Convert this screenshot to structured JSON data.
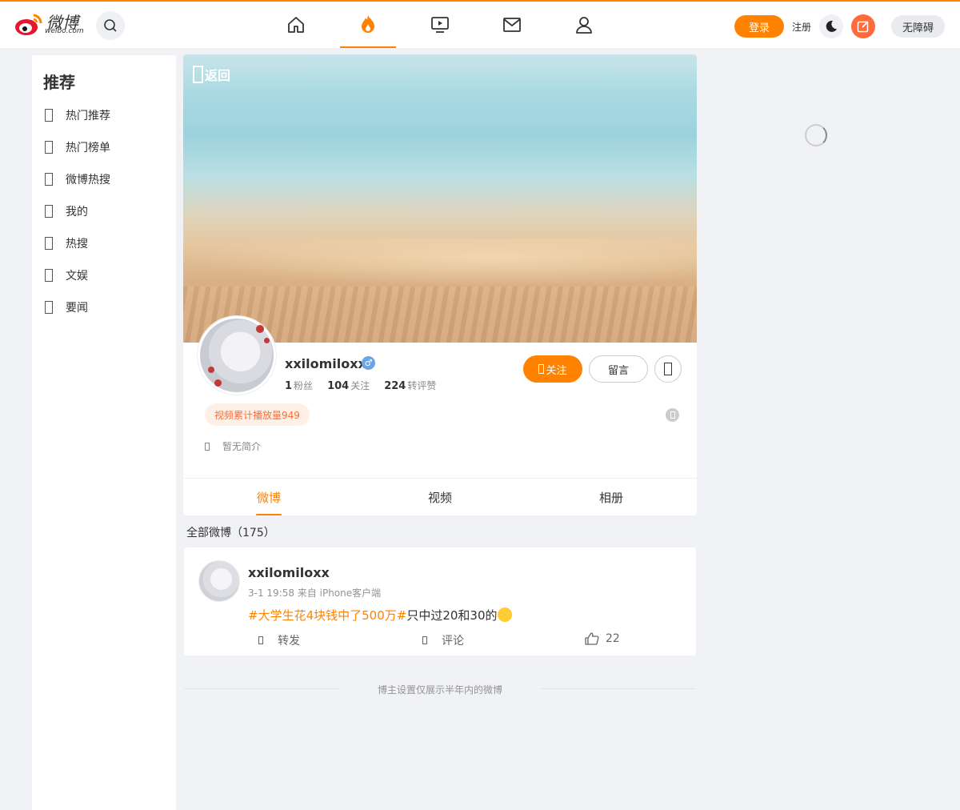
{
  "header": {
    "logo_text": "微博",
    "logo_sub": "weibo.com",
    "login_label": "登录",
    "register_label": "注册",
    "accessibility_label": "无障碍"
  },
  "sidebar": {
    "title": "推荐",
    "items": [
      {
        "label": "热门推荐"
      },
      {
        "label": "热门榜单"
      },
      {
        "label": "微博热搜"
      },
      {
        "label": "我的"
      },
      {
        "label": "热搜"
      },
      {
        "label": "文娱"
      },
      {
        "label": "要闻"
      }
    ]
  },
  "profile": {
    "back_label": "返回",
    "username": "xxilomiloxx",
    "gender_symbol": "♂",
    "stats": [
      {
        "num": "1",
        "label": "粉丝"
      },
      {
        "num": "104",
        "label": "关注"
      },
      {
        "num": "224",
        "label": "转评赞"
      }
    ],
    "follow_label": "关注",
    "message_label": "留言",
    "tag": "视频累计播放量949",
    "bio": "暂无简介",
    "tabs": [
      {
        "label": "微博"
      },
      {
        "label": "视频"
      },
      {
        "label": "相册"
      }
    ]
  },
  "feed": {
    "all_label": "全部微博（175）",
    "post": {
      "username": "xxilomiloxx",
      "meta": "3-1 19:58  来自 iPhone客户端",
      "topic": "#大学生花4块钱中了500万#",
      "text": "只中过20和30的",
      "repost_label": "转发",
      "comment_label": "评论",
      "like_count": "22"
    },
    "limit_note": "博主设置仅展示半年内的微博"
  },
  "colors": {
    "accent": "#ff8200",
    "write_button": "#ff6b3a",
    "page_bg": "#f1f2f5"
  },
  "icons": [
    "search-icon",
    "home-icon",
    "hot-icon",
    "video-icon",
    "mail-icon",
    "profile-icon",
    "moon-icon",
    "edit-icon",
    "male-icon",
    "like-icon"
  ]
}
